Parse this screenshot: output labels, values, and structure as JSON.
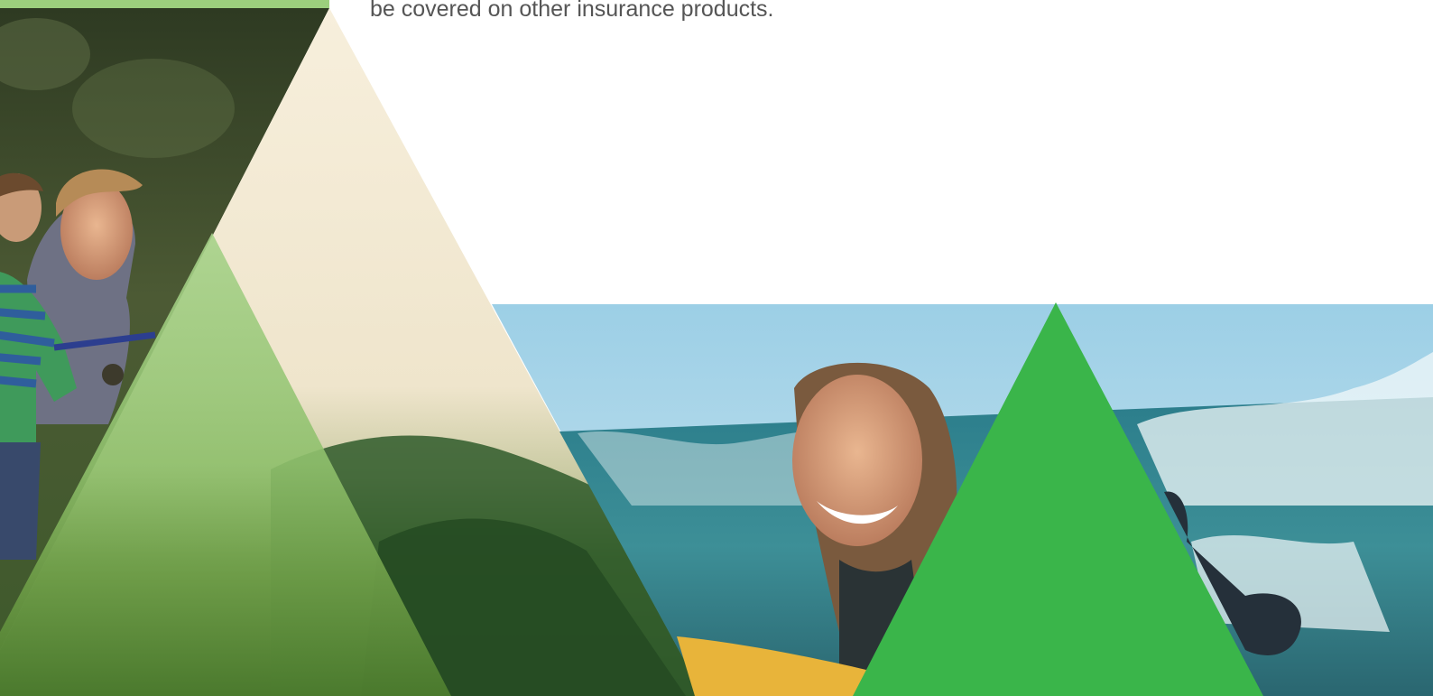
{
  "document": {
    "body_text": "be covered on other insurance products."
  },
  "images": {
    "family_fishing": "photo of a father and young son fishing outdoors",
    "forest_hills": "photo of misty forested hills",
    "surfer": "photo of a smiling woman surfing in ocean waves"
  },
  "colors": {
    "top_bar": "#9ccf7d",
    "beige_triangle": "#f6ecd6",
    "light_green_triangle": "#9ccf7d",
    "bright_green_triangle": "#3ab54a",
    "body_text": "#555555"
  }
}
